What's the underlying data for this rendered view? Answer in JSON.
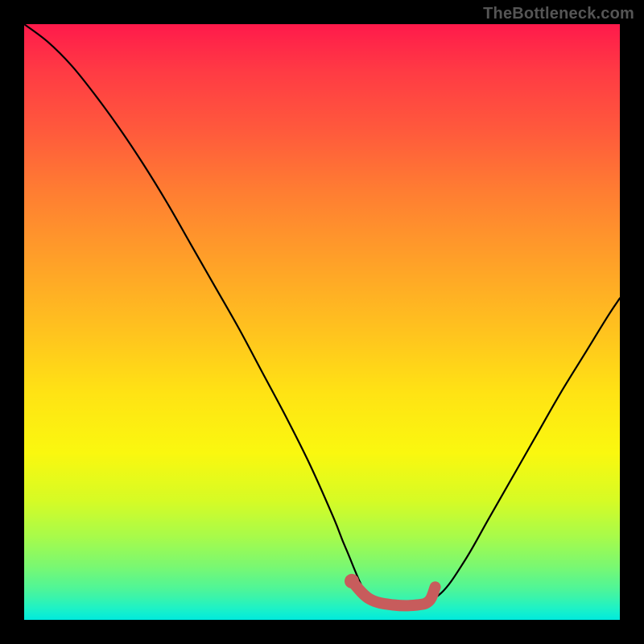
{
  "watermark": "TheBottleneck.com",
  "chart_data": {
    "type": "line",
    "title": "",
    "xlabel": "",
    "ylabel": "",
    "xlim": [
      0,
      100
    ],
    "ylim": [
      0,
      100
    ],
    "grid": false,
    "series": [
      {
        "name": "bottleneck-curve",
        "color": "#000000",
        "x": [
          0,
          4,
          8,
          12,
          16,
          20,
          24,
          28,
          32,
          36,
          40,
          44,
          48,
          52,
          54,
          58,
          62,
          66,
          70,
          74,
          78,
          82,
          86,
          90,
          94,
          98,
          100
        ],
        "y": [
          100,
          97,
          93,
          88,
          82.5,
          76.5,
          70,
          63,
          56,
          49,
          41.5,
          34,
          26,
          17,
          12,
          3.5,
          2.5,
          2.5,
          4.5,
          10,
          17,
          24,
          31,
          38,
          44.5,
          51,
          54
        ]
      },
      {
        "name": "highlight-segment",
        "color": "#c75c5c",
        "x": [
          55,
          58,
          62,
          66,
          68,
          69
        ],
        "y": [
          6.5,
          3.5,
          2.5,
          2.5,
          3.2,
          5.5
        ]
      }
    ],
    "marker": {
      "name": "highlight-dot",
      "color": "#c75c5c",
      "x": 55,
      "y": 6.5
    }
  }
}
